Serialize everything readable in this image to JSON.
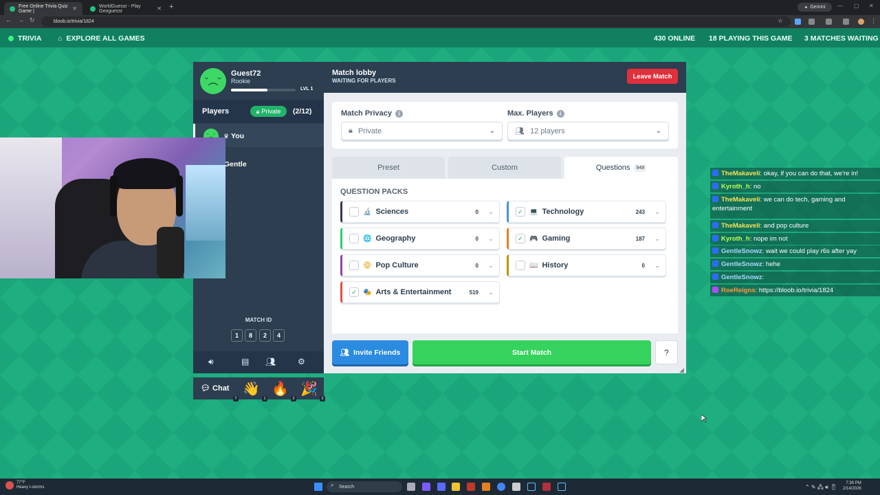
{
  "browser": {
    "tabs": [
      {
        "title": "Free Online Trivia Quiz Game |"
      },
      {
        "title": "WorldGuessr - Play Geoguessr"
      }
    ],
    "url": "bloob.io/trivia/1824",
    "gemini_label": "Gemini"
  },
  "site_header": {
    "trivia_label": "TRIVIA",
    "explore_label": "EXPLORE ALL GAMES",
    "online": "430 ONLINE",
    "playing": "18 PLAYING THIS GAME",
    "matches_waiting": "3 MATCHES WAITING"
  },
  "profile": {
    "name": "Guest72",
    "rank": "Rookie",
    "level": "LVL 1",
    "xp_fraction": 0.56
  },
  "players": {
    "label": "Players",
    "privacy_badge": "Private",
    "count": "(2/12)",
    "list": [
      {
        "name": "You"
      },
      {
        "name": "Gentle"
      }
    ]
  },
  "match": {
    "id_label": "MATCH ID",
    "id_digits": [
      "1",
      "8",
      "2",
      "4"
    ]
  },
  "chat_bar": {
    "chat_label": "Chat",
    "reactions": [
      {
        "icon": "👋",
        "count": "1"
      },
      {
        "icon": "🔥",
        "count": "2"
      },
      {
        "icon": "🎉",
        "count": "3"
      }
    ],
    "first_count": "T"
  },
  "lobby": {
    "title": "Match lobby",
    "subtitle": "WAITING FOR PLAYERS",
    "leave_label": "Leave Match"
  },
  "settings": {
    "privacy_label": "Match Privacy",
    "privacy_value": "Private",
    "max_players_label": "Max. Players",
    "max_players_value": "12 players"
  },
  "tabs": {
    "preset": "Preset",
    "custom": "Custom",
    "questions": "Questions",
    "questions_count": "949"
  },
  "packs": {
    "title": "QUESTION PACKS",
    "items": [
      {
        "name": "Sciences",
        "count": "0",
        "checked": false,
        "color": "#2c3e4f",
        "icon": "🔬"
      },
      {
        "name": "Technology",
        "count": "243",
        "checked": true,
        "color": "#4a90d9",
        "icon": "💻"
      },
      {
        "name": "Geography",
        "count": "0",
        "checked": false,
        "color": "#2ecc71",
        "icon": "🌐"
      },
      {
        "name": "Gaming",
        "count": "187",
        "checked": true,
        "color": "#e67e22",
        "icon": "🎮"
      },
      {
        "name": "Pop Culture",
        "count": "0",
        "checked": false,
        "color": "#8e44ad",
        "icon": "📀"
      },
      {
        "name": "History",
        "count": "0",
        "checked": false,
        "color": "#b7950b",
        "icon": "📖"
      },
      {
        "name": "Arts & Entertainment",
        "count": "519",
        "checked": true,
        "color": "#e74c3c",
        "icon": "🎭"
      }
    ]
  },
  "actions": {
    "invite_label": "Invite Friends",
    "start_label": "Start Match",
    "help_label": "?"
  },
  "chat_log": [
    {
      "user": "TheMakaveli",
      "color": "#f7e35a",
      "text": ": okay, if you can do that, we're in!"
    },
    {
      "user": "Kyroth_h",
      "color": "#b8ff5a",
      "text": ": no"
    },
    {
      "user": "TheMakaveli",
      "color": "#f7e35a",
      "text": ": we can do tech, gaming and entertainment"
    },
    {
      "user": "TheMakaveli",
      "color": "#f7e35a",
      "text": ": and pop culture"
    },
    {
      "user": "Kyroth_h",
      "color": "#b8ff5a",
      "text": ": nope im not"
    },
    {
      "user": "GentleSnowz",
      "color": "#a8d8ff",
      "text": ": wait we could play r6s after yay"
    },
    {
      "user": "GentleSnowz",
      "color": "#a8d8ff",
      "text": ": hehe"
    },
    {
      "user": "GentleSnowz",
      "color": "#a8d8ff",
      "text": ": "
    },
    {
      "user": "RoeReigns",
      "color": "#ff9b3d",
      "text": ": https://bloob.io/trivia/1824"
    }
  ],
  "taskbar": {
    "weather_temp": "77°F",
    "weather_desc": "Heavy t-storms",
    "search_label": "Search",
    "time": "7:39 PM",
    "date": "2/14/2026"
  }
}
